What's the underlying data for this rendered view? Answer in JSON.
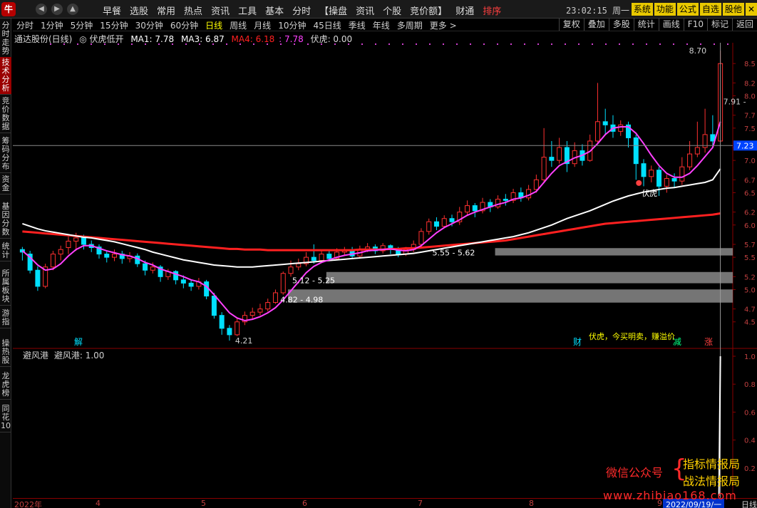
{
  "menubar": {
    "logo": "牛",
    "nav": [
      "◀",
      "▶",
      "▲"
    ],
    "items": [
      "早餐",
      "选股",
      "常用",
      "热点",
      "资讯",
      "工具",
      "基本",
      "分时",
      "【操盘",
      "资讯",
      "个股",
      "竞价额】",
      "财通",
      "排序"
    ],
    "clock": "23:02:15 周一",
    "right_buttons": [
      "系统",
      "功能",
      "公式",
      "自选",
      "股他",
      "✕"
    ]
  },
  "sidebar": {
    "tabs": [
      "分时走势",
      "技术分析",
      "竞价数据",
      "筹码分布",
      "资金",
      "基因分数",
      "统计",
      "所属板块",
      "游指",
      "操热股",
      "龙虎榜",
      "同花10"
    ]
  },
  "period_bar": {
    "periods": [
      "分时",
      "1分钟",
      "5分钟",
      "15分钟",
      "30分钟",
      "60分钟",
      "日线",
      "周线",
      "月线",
      "10分钟",
      "45日线",
      "季线",
      "年线",
      "多周期",
      "更多 >"
    ],
    "active": "日线",
    "tools": [
      "复权",
      "叠加",
      "多股",
      "统计",
      "画线",
      "F10",
      "标记",
      "返回"
    ]
  },
  "indicator": {
    "stock_name": "通达股份(日线)",
    "formula": "◎ 伏虎低开",
    "ma1": "MA1: 7.78",
    "ma3": "MA3: 6.87",
    "ma4": "MA4: 6.18",
    "extra": ": 7.78",
    "fuhu": "伏虎: 0.00",
    "ma1_color": "#ffffff",
    "ma3_color": "#ffffff",
    "ma4_color": "#ff2020",
    "extra_color": "#ff40ff"
  },
  "sub_indicator": {
    "label": "避风港",
    "value": "避风港: 1.00"
  },
  "annotations": {
    "peak": "8.70",
    "cur_line": "7.91 -",
    "current_price": "7.23",
    "low": "4.21",
    "zone1": "4.82 - 4.98",
    "zone2": "5.12 - 5.25",
    "zone3": "5.55 - 5.62",
    "fuhu_tag": "伏虎",
    "legend_text": "伏虎，今买明卖，赚溢价",
    "tag_jie": "解",
    "tag_cai": "财",
    "tag_jian": "减",
    "tag_zhang": "涨"
  },
  "price_axis": [
    "8.5",
    "8.2",
    "8.0",
    "7.7",
    "7.5",
    "7.2",
    "7.0",
    "6.7",
    "6.5",
    "6.2",
    "6.0",
    "5.7",
    "5.5",
    "5.2",
    "5.0",
    "4.7",
    "4.5"
  ],
  "sub_axis": [
    "1.0",
    "0.8",
    "0.6",
    "0.4",
    "0.2"
  ],
  "x_axis": {
    "labels": [
      "2022年",
      "4",
      "5",
      "6",
      "7",
      "8",
      "9"
    ],
    "date_tag": "2022/09/19/一",
    "period": "日线"
  },
  "watermark": {
    "left": "微信公众号",
    "brace": "{",
    "r1": "指标情报局",
    "r2": "战法情报局",
    "url": "www.zhibiao168.com"
  },
  "chart_data": {
    "type": "line",
    "title": "通达股份(日线)",
    "ylim": [
      4.1,
      8.8
    ],
    "price_ticks": [
      8.5,
      8.2,
      8.0,
      7.7,
      7.5,
      7.2,
      7.0,
      6.7,
      6.5,
      6.2,
      6.0,
      5.7,
      5.5,
      5.2,
      5.0,
      4.7,
      4.5
    ],
    "candles": [
      [
        5.62,
        5.58,
        5.66,
        5.45
      ],
      [
        5.55,
        5.3,
        5.6,
        5.25
      ],
      [
        5.3,
        5.05,
        5.36,
        4.98
      ],
      [
        5.05,
        5.35,
        5.4,
        5.02
      ],
      [
        5.35,
        5.55,
        5.6,
        5.3
      ],
      [
        5.55,
        5.62,
        5.68,
        5.45
      ],
      [
        5.65,
        5.75,
        5.82,
        5.55
      ],
      [
        5.75,
        5.8,
        5.88,
        5.6
      ],
      [
        5.8,
        5.7,
        5.85,
        5.62
      ],
      [
        5.7,
        5.65,
        5.76,
        5.58
      ],
      [
        5.66,
        5.55,
        5.7,
        5.48
      ],
      [
        5.55,
        5.5,
        5.6,
        5.42
      ],
      [
        5.5,
        5.55,
        5.62,
        5.44
      ],
      [
        5.55,
        5.48,
        5.6,
        5.4
      ],
      [
        5.48,
        5.52,
        5.58,
        5.42
      ],
      [
        5.52,
        5.4,
        5.56,
        5.35
      ],
      [
        5.4,
        5.3,
        5.45,
        5.22
      ],
      [
        5.3,
        5.35,
        5.42,
        5.25
      ],
      [
        5.35,
        5.2,
        5.38,
        5.12
      ],
      [
        5.2,
        5.28,
        5.32,
        5.15
      ],
      [
        5.28,
        5.15,
        5.3,
        5.08
      ],
      [
        5.15,
        5.1,
        5.22,
        5.02
      ],
      [
        5.1,
        5.05,
        5.15,
        4.98
      ],
      [
        5.05,
        5.12,
        5.18,
        5.0
      ],
      [
        5.12,
        4.9,
        5.15,
        4.85
      ],
      [
        4.9,
        4.6,
        4.95,
        4.55
      ],
      [
        4.6,
        4.4,
        4.65,
        4.3
      ],
      [
        4.4,
        4.3,
        4.45,
        4.21
      ],
      [
        4.3,
        4.5,
        4.55,
        4.28
      ],
      [
        4.5,
        4.6,
        4.66,
        4.45
      ],
      [
        4.6,
        4.65,
        4.72,
        4.55
      ],
      [
        4.65,
        4.7,
        4.78,
        4.6
      ],
      [
        4.7,
        4.8,
        4.86,
        4.66
      ],
      [
        4.8,
        4.95,
        5.0,
        4.78
      ],
      [
        4.95,
        5.25,
        5.28,
        4.92
      ],
      [
        5.25,
        5.35,
        5.45,
        5.2
      ],
      [
        5.35,
        5.4,
        5.48,
        5.3
      ],
      [
        5.4,
        5.5,
        5.58,
        5.36
      ],
      [
        5.5,
        5.45,
        5.7,
        5.4
      ],
      [
        5.45,
        5.55,
        5.6,
        5.42
      ],
      [
        5.55,
        5.48,
        5.62,
        5.44
      ],
      [
        5.48,
        5.58,
        5.64,
        5.46
      ],
      [
        5.58,
        5.6,
        5.66,
        5.52
      ],
      [
        5.6,
        5.52,
        5.66,
        5.48
      ],
      [
        5.52,
        5.62,
        5.68,
        5.5
      ],
      [
        5.62,
        5.66,
        5.72,
        5.58
      ],
      [
        5.66,
        5.6,
        5.7,
        5.55
      ],
      [
        5.6,
        5.68,
        5.72,
        5.56
      ],
      [
        5.68,
        5.62,
        5.7,
        5.55
      ],
      [
        5.62,
        5.55,
        5.66,
        5.5
      ],
      [
        5.55,
        5.62,
        5.66,
        5.52
      ],
      [
        5.62,
        5.7,
        5.76,
        5.58
      ],
      [
        5.7,
        5.9,
        5.95,
        5.66
      ],
      [
        5.9,
        6.05,
        6.1,
        5.85
      ],
      [
        6.05,
        5.98,
        6.12,
        5.92
      ],
      [
        5.98,
        6.1,
        6.15,
        5.95
      ],
      [
        6.1,
        6.05,
        6.16,
        5.98
      ],
      [
        6.05,
        6.2,
        6.28,
        6.0
      ],
      [
        6.2,
        6.3,
        6.38,
        6.14
      ],
      [
        6.3,
        6.22,
        6.34,
        6.12
      ],
      [
        6.22,
        6.35,
        6.42,
        6.18
      ],
      [
        6.35,
        6.28,
        6.4,
        6.2
      ],
      [
        6.28,
        6.4,
        6.46,
        6.25
      ],
      [
        6.4,
        6.38,
        6.48,
        6.3
      ],
      [
        6.38,
        6.5,
        6.56,
        6.34
      ],
      [
        6.5,
        6.42,
        6.58,
        6.36
      ],
      [
        6.42,
        6.55,
        6.62,
        6.38
      ],
      [
        6.55,
        6.7,
        6.78,
        6.5
      ],
      [
        6.7,
        7.05,
        7.5,
        6.66
      ],
      [
        7.05,
        7.0,
        7.3,
        6.9
      ],
      [
        7.0,
        7.2,
        7.35,
        6.95
      ],
      [
        7.2,
        6.95,
        7.3,
        6.82
      ],
      [
        6.95,
        7.15,
        7.28,
        6.9
      ],
      [
        7.15,
        7.0,
        7.25,
        6.92
      ],
      [
        7.0,
        7.3,
        7.4,
        6.98
      ],
      [
        7.3,
        7.6,
        8.2,
        7.25
      ],
      [
        7.6,
        7.55,
        7.8,
        7.4
      ],
      [
        7.55,
        7.45,
        7.7,
        7.35
      ],
      [
        7.45,
        7.55,
        7.62,
        7.38
      ],
      [
        7.55,
        7.35,
        7.6,
        7.2
      ],
      [
        7.35,
        6.95,
        7.4,
        6.7
      ],
      [
        6.95,
        6.75,
        7.02,
        6.6
      ],
      [
        6.75,
        6.85,
        6.92,
        6.66
      ],
      [
        6.85,
        6.6,
        6.9,
        6.45
      ],
      [
        6.6,
        6.72,
        6.78,
        6.5
      ],
      [
        6.72,
        6.68,
        6.8,
        6.58
      ],
      [
        6.68,
        6.9,
        7.05,
        6.62
      ],
      [
        6.9,
        7.1,
        7.3,
        6.85
      ],
      [
        7.1,
        7.2,
        7.6,
        7.05
      ],
      [
        7.2,
        7.4,
        7.8,
        7.12
      ],
      [
        7.4,
        7.3,
        7.7,
        7.2
      ],
      [
        7.3,
        8.5,
        8.7,
        7.28
      ]
    ],
    "ma1": [
      5.6,
      5.5,
      5.38,
      5.3,
      5.32,
      5.4,
      5.52,
      5.62,
      5.68,
      5.68,
      5.64,
      5.6,
      5.57,
      5.54,
      5.52,
      5.48,
      5.42,
      5.38,
      5.32,
      5.28,
      5.24,
      5.2,
      5.15,
      5.12,
      5.05,
      4.92,
      4.78,
      4.64,
      4.56,
      4.52,
      4.54,
      4.58,
      4.64,
      4.72,
      4.84,
      4.98,
      5.12,
      5.26,
      5.36,
      5.42,
      5.46,
      5.5,
      5.53,
      5.55,
      5.57,
      5.6,
      5.61,
      5.62,
      5.63,
      5.61,
      5.6,
      5.62,
      5.68,
      5.78,
      5.88,
      5.96,
      6.02,
      6.08,
      6.15,
      6.2,
      6.24,
      6.28,
      6.32,
      6.35,
      6.4,
      6.42,
      6.46,
      6.52,
      6.66,
      6.8,
      6.92,
      6.98,
      7.04,
      7.08,
      7.14,
      7.26,
      7.4,
      7.5,
      7.52,
      7.52,
      7.42,
      7.26,
      7.08,
      6.92,
      6.8,
      6.74,
      6.74,
      6.8,
      6.92,
      7.06,
      7.2,
      7.6
    ],
    "ma3": [
      6.02,
      5.98,
      5.94,
      5.91,
      5.89,
      5.87,
      5.85,
      5.83,
      5.81,
      5.8,
      5.78,
      5.76,
      5.74,
      5.71,
      5.68,
      5.65,
      5.62,
      5.58,
      5.55,
      5.52,
      5.49,
      5.46,
      5.44,
      5.42,
      5.4,
      5.38,
      5.37,
      5.36,
      5.35,
      5.35,
      5.35,
      5.36,
      5.37,
      5.38,
      5.39,
      5.4,
      5.41,
      5.42,
      5.43,
      5.44,
      5.45,
      5.46,
      5.47,
      5.48,
      5.49,
      5.5,
      5.51,
      5.52,
      5.53,
      5.54,
      5.55,
      5.56,
      5.58,
      5.6,
      5.62,
      5.64,
      5.66,
      5.68,
      5.7,
      5.72,
      5.74,
      5.76,
      5.78,
      5.8,
      5.82,
      5.85,
      5.88,
      5.92,
      5.96,
      6.0,
      6.05,
      6.1,
      6.14,
      6.18,
      6.22,
      6.27,
      6.32,
      6.37,
      6.41,
      6.45,
      6.48,
      6.51,
      6.53,
      6.55,
      6.57,
      6.58,
      6.6,
      6.62,
      6.64,
      6.66,
      6.7,
      6.87
    ],
    "ma4": [
      5.9,
      5.89,
      5.88,
      5.87,
      5.86,
      5.85,
      5.84,
      5.83,
      5.82,
      5.81,
      5.8,
      5.79,
      5.78,
      5.77,
      5.76,
      5.75,
      5.74,
      5.73,
      5.72,
      5.71,
      5.7,
      5.69,
      5.68,
      5.67,
      5.66,
      5.65,
      5.64,
      5.63,
      5.63,
      5.62,
      5.62,
      5.62,
      5.61,
      5.61,
      5.61,
      5.61,
      5.61,
      5.61,
      5.61,
      5.61,
      5.61,
      5.61,
      5.61,
      5.61,
      5.62,
      5.62,
      5.62,
      5.62,
      5.63,
      5.63,
      5.64,
      5.64,
      5.65,
      5.66,
      5.67,
      5.68,
      5.69,
      5.7,
      5.71,
      5.72,
      5.73,
      5.74,
      5.75,
      5.76,
      5.78,
      5.8,
      5.82,
      5.84,
      5.86,
      5.88,
      5.9,
      5.92,
      5.94,
      5.96,
      5.98,
      6.0,
      6.02,
      6.03,
      6.04,
      6.05,
      6.06,
      6.07,
      6.08,
      6.09,
      6.1,
      6.11,
      6.12,
      6.13,
      6.14,
      6.15,
      6.16,
      6.18
    ],
    "support_zones": [
      [
        5.55,
        5.62
      ],
      [
        5.12,
        5.25
      ],
      [
        4.82,
        4.98
      ]
    ],
    "sub_series": {
      "name": "避风港",
      "last": 1.0
    },
    "colors": {
      "up": "#ff3030",
      "down": "#00e0ff",
      "ma1": "#ff40ff",
      "ma3": "#ffffff",
      "ma4": "#ff2020",
      "zone": "#8a8a8a"
    }
  }
}
